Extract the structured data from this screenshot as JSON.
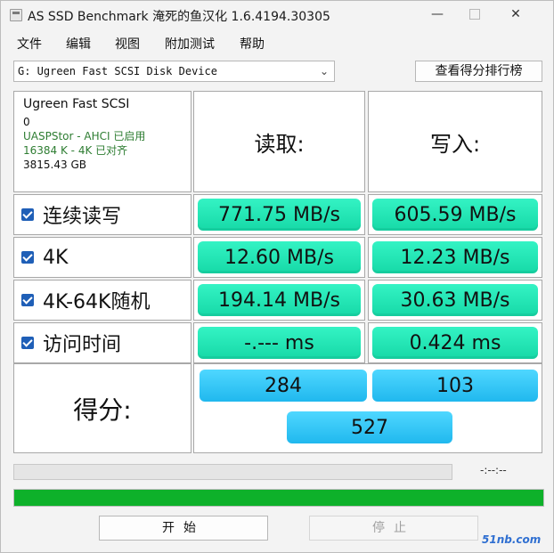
{
  "window": {
    "title": "AS SSD Benchmark 淹死的鱼汉化 1.6.4194.30305"
  },
  "menu": [
    "文件",
    "编辑",
    "视图",
    "附加测试",
    "帮助"
  ],
  "toolbar": {
    "device_value": "G: Ugreen Fast SCSI Disk Device",
    "rank_button": "查看得分排行榜"
  },
  "info": {
    "device": "Ugreen Fast SCSI",
    "line0": "0",
    "driver": "UASPStor - AHCI 已启用",
    "alignment": "16384 K - 4K 已对齐",
    "capacity": "3815.43 GB"
  },
  "headers": {
    "read": "读取:",
    "write": "写入:"
  },
  "rows": [
    {
      "label": "连续读写",
      "read": "771.75 MB/s",
      "write": "605.59 MB/s",
      "checked": true
    },
    {
      "label": "4K",
      "read": "12.60 MB/s",
      "write": "12.23 MB/s",
      "checked": true
    },
    {
      "label": "4K-64K随机",
      "read": "194.14 MB/s",
      "write": "30.63 MB/s",
      "checked": true
    },
    {
      "label": "访问时间",
      "read": "-.--- ms",
      "write": "0.424 ms",
      "checked": true
    }
  ],
  "score": {
    "label": "得分:",
    "read": "284",
    "write": "103",
    "total": "527"
  },
  "progress": {
    "time": "-:--:--",
    "total_fraction": 1.0
  },
  "buttons": {
    "start": "开始",
    "stop": "停止"
  },
  "watermark": "51nb.com",
  "colors": {
    "value_pill": "#25e5b6",
    "score_pill": "#37c8f6",
    "progress_fill": "#0eb12a",
    "checkbox": "#1f5fb7"
  }
}
